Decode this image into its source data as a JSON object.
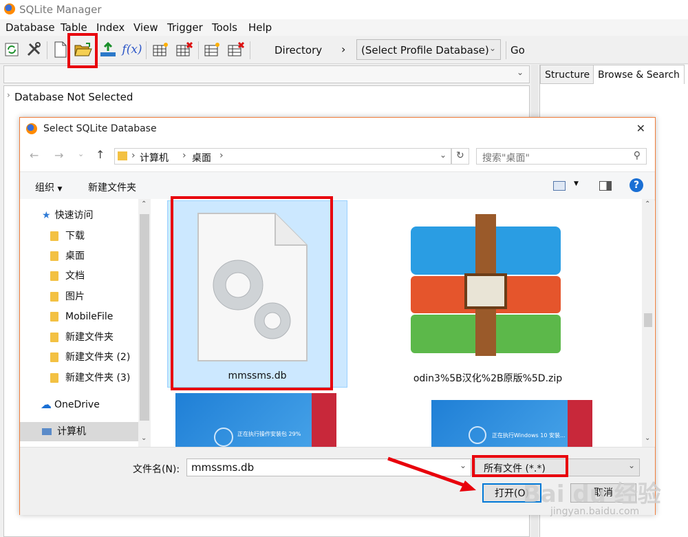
{
  "app": {
    "title": "SQLite Manager"
  },
  "menu": [
    "Database",
    "Table",
    "Index",
    "View",
    "Trigger",
    "Tools",
    "Help"
  ],
  "toolbar": {
    "directory_label": "Directory",
    "chevron": "›",
    "profile_select": "(Select Profile Database)",
    "go_label": "Go",
    "fx_label": "f(x)"
  },
  "left_pane": {
    "tree_root": "Database Not Selected"
  },
  "right_pane": {
    "tabs": [
      "Structure",
      "Browse & Search"
    ]
  },
  "dialog": {
    "title": "Select SQLite Database",
    "close": "✕",
    "breadcrumb": [
      "计算机",
      "桌面"
    ],
    "search_placeholder": "搜索\"桌面\"",
    "commands": {
      "organize": "组织",
      "new_folder": "新建文件夹"
    },
    "nav_items": [
      {
        "label": "快速访问"
      },
      {
        "label": "下载"
      },
      {
        "label": "桌面"
      },
      {
        "label": "文档"
      },
      {
        "label": "图片"
      },
      {
        "label": "MobileFile"
      },
      {
        "label": "新建文件夹"
      },
      {
        "label": "新建文件夹 (2)"
      },
      {
        "label": "新建文件夹 (3)"
      },
      {
        "label": "OneDrive"
      },
      {
        "label": "计算机"
      }
    ],
    "files": [
      {
        "name": "mmssms.db",
        "selected": true
      },
      {
        "name": "odin3%5B汉化%2B原版%5D.zip",
        "selected": false
      },
      {
        "name": "",
        "thumb_text": "正在执行操作安装包 29%"
      },
      {
        "name": "",
        "thumb_text": "正在执行Windows 10 安装..."
      }
    ],
    "filename_label": "文件名(N):",
    "filename_value": "mmssms.db",
    "filter_value": "所有文件 (*.*)",
    "open_button": "打开(O)",
    "cancel_button": "取消"
  },
  "watermark": {
    "brand": "Bai du 经验",
    "url": "jingyan.baidu.com"
  },
  "colors": {
    "highlight": "#e8000b",
    "accent": "#f07d3a",
    "selection": "#cce8ff",
    "folder": "#f3c143"
  }
}
